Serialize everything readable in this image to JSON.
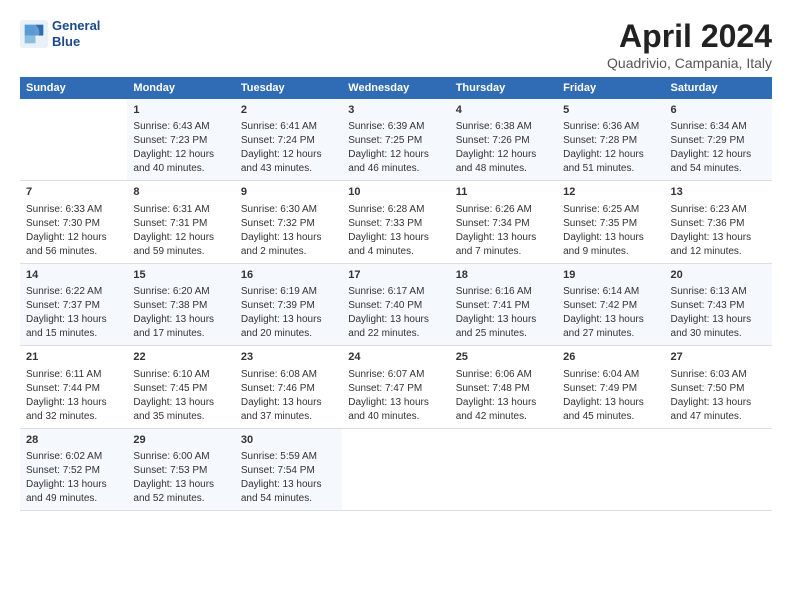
{
  "header": {
    "logo_line1": "General",
    "logo_line2": "Blue",
    "title": "April 2024",
    "subtitle": "Quadrivio, Campania, Italy"
  },
  "weekdays": [
    "Sunday",
    "Monday",
    "Tuesday",
    "Wednesday",
    "Thursday",
    "Friday",
    "Saturday"
  ],
  "rows": [
    [
      {
        "day": "",
        "content": ""
      },
      {
        "day": "1",
        "content": "Sunrise: 6:43 AM\nSunset: 7:23 PM\nDaylight: 12 hours\nand 40 minutes."
      },
      {
        "day": "2",
        "content": "Sunrise: 6:41 AM\nSunset: 7:24 PM\nDaylight: 12 hours\nand 43 minutes."
      },
      {
        "day": "3",
        "content": "Sunrise: 6:39 AM\nSunset: 7:25 PM\nDaylight: 12 hours\nand 46 minutes."
      },
      {
        "day": "4",
        "content": "Sunrise: 6:38 AM\nSunset: 7:26 PM\nDaylight: 12 hours\nand 48 minutes."
      },
      {
        "day": "5",
        "content": "Sunrise: 6:36 AM\nSunset: 7:28 PM\nDaylight: 12 hours\nand 51 minutes."
      },
      {
        "day": "6",
        "content": "Sunrise: 6:34 AM\nSunset: 7:29 PM\nDaylight: 12 hours\nand 54 minutes."
      }
    ],
    [
      {
        "day": "7",
        "content": "Sunrise: 6:33 AM\nSunset: 7:30 PM\nDaylight: 12 hours\nand 56 minutes."
      },
      {
        "day": "8",
        "content": "Sunrise: 6:31 AM\nSunset: 7:31 PM\nDaylight: 12 hours\nand 59 minutes."
      },
      {
        "day": "9",
        "content": "Sunrise: 6:30 AM\nSunset: 7:32 PM\nDaylight: 13 hours\nand 2 minutes."
      },
      {
        "day": "10",
        "content": "Sunrise: 6:28 AM\nSunset: 7:33 PM\nDaylight: 13 hours\nand 4 minutes."
      },
      {
        "day": "11",
        "content": "Sunrise: 6:26 AM\nSunset: 7:34 PM\nDaylight: 13 hours\nand 7 minutes."
      },
      {
        "day": "12",
        "content": "Sunrise: 6:25 AM\nSunset: 7:35 PM\nDaylight: 13 hours\nand 9 minutes."
      },
      {
        "day": "13",
        "content": "Sunrise: 6:23 AM\nSunset: 7:36 PM\nDaylight: 13 hours\nand 12 minutes."
      }
    ],
    [
      {
        "day": "14",
        "content": "Sunrise: 6:22 AM\nSunset: 7:37 PM\nDaylight: 13 hours\nand 15 minutes."
      },
      {
        "day": "15",
        "content": "Sunrise: 6:20 AM\nSunset: 7:38 PM\nDaylight: 13 hours\nand 17 minutes."
      },
      {
        "day": "16",
        "content": "Sunrise: 6:19 AM\nSunset: 7:39 PM\nDaylight: 13 hours\nand 20 minutes."
      },
      {
        "day": "17",
        "content": "Sunrise: 6:17 AM\nSunset: 7:40 PM\nDaylight: 13 hours\nand 22 minutes."
      },
      {
        "day": "18",
        "content": "Sunrise: 6:16 AM\nSunset: 7:41 PM\nDaylight: 13 hours\nand 25 minutes."
      },
      {
        "day": "19",
        "content": "Sunrise: 6:14 AM\nSunset: 7:42 PM\nDaylight: 13 hours\nand 27 minutes."
      },
      {
        "day": "20",
        "content": "Sunrise: 6:13 AM\nSunset: 7:43 PM\nDaylight: 13 hours\nand 30 minutes."
      }
    ],
    [
      {
        "day": "21",
        "content": "Sunrise: 6:11 AM\nSunset: 7:44 PM\nDaylight: 13 hours\nand 32 minutes."
      },
      {
        "day": "22",
        "content": "Sunrise: 6:10 AM\nSunset: 7:45 PM\nDaylight: 13 hours\nand 35 minutes."
      },
      {
        "day": "23",
        "content": "Sunrise: 6:08 AM\nSunset: 7:46 PM\nDaylight: 13 hours\nand 37 minutes."
      },
      {
        "day": "24",
        "content": "Sunrise: 6:07 AM\nSunset: 7:47 PM\nDaylight: 13 hours\nand 40 minutes."
      },
      {
        "day": "25",
        "content": "Sunrise: 6:06 AM\nSunset: 7:48 PM\nDaylight: 13 hours\nand 42 minutes."
      },
      {
        "day": "26",
        "content": "Sunrise: 6:04 AM\nSunset: 7:49 PM\nDaylight: 13 hours\nand 45 minutes."
      },
      {
        "day": "27",
        "content": "Sunrise: 6:03 AM\nSunset: 7:50 PM\nDaylight: 13 hours\nand 47 minutes."
      }
    ],
    [
      {
        "day": "28",
        "content": "Sunrise: 6:02 AM\nSunset: 7:52 PM\nDaylight: 13 hours\nand 49 minutes."
      },
      {
        "day": "29",
        "content": "Sunrise: 6:00 AM\nSunset: 7:53 PM\nDaylight: 13 hours\nand 52 minutes."
      },
      {
        "day": "30",
        "content": "Sunrise: 5:59 AM\nSunset: 7:54 PM\nDaylight: 13 hours\nand 54 minutes."
      },
      {
        "day": "",
        "content": ""
      },
      {
        "day": "",
        "content": ""
      },
      {
        "day": "",
        "content": ""
      },
      {
        "day": "",
        "content": ""
      }
    ]
  ]
}
